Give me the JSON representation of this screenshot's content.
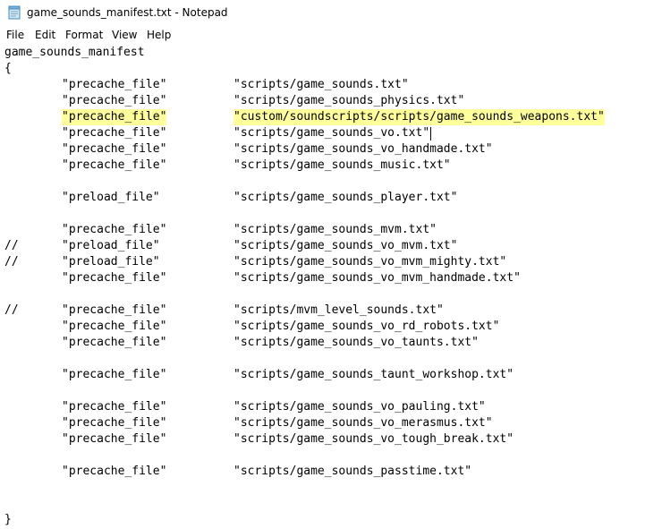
{
  "window": {
    "title": "game_sounds_manifest.txt - Notepad"
  },
  "menu": {
    "items": [
      "File",
      "Edit",
      "Format",
      "View",
      "Help"
    ]
  },
  "editor": {
    "lines": [
      {
        "c": "game_sounds_manifest",
        "k": "",
        "v": ""
      },
      {
        "c": "{",
        "k": "",
        "v": ""
      },
      {
        "c": "",
        "k": "\"precache_file\"",
        "v": "\"scripts/game_sounds.txt\""
      },
      {
        "c": "",
        "k": "\"precache_file\"",
        "v": "\"scripts/game_sounds_physics.txt\""
      },
      {
        "c": "",
        "k": "\"precache_file\"",
        "v": "\"custom/soundscripts/scripts/game_sounds_weapons.txt\""
      },
      {
        "c": "",
        "k": "\"precache_file\"",
        "v": "\"scripts/game_sounds_vo.txt\""
      },
      {
        "c": "",
        "k": "\"precache_file\"",
        "v": "\"scripts/game_sounds_vo_handmade.txt\""
      },
      {
        "c": "",
        "k": "\"precache_file\"",
        "v": "\"scripts/game_sounds_music.txt\""
      },
      {
        "c": "",
        "k": "",
        "v": ""
      },
      {
        "c": "",
        "k": "\"preload_file\"",
        "v": "\"scripts/game_sounds_player.txt\""
      },
      {
        "c": "",
        "k": "",
        "v": ""
      },
      {
        "c": "",
        "k": "\"precache_file\"",
        "v": "\"scripts/game_sounds_mvm.txt\""
      },
      {
        "c": "//",
        "k": "\"preload_file\"",
        "v": "\"scripts/game_sounds_vo_mvm.txt\""
      },
      {
        "c": "//",
        "k": "\"preload_file\"",
        "v": "\"scripts/game_sounds_vo_mvm_mighty.txt\""
      },
      {
        "c": "",
        "k": "\"precache_file\"",
        "v": "\"scripts/game_sounds_vo_mvm_handmade.txt\""
      },
      {
        "c": "",
        "k": "",
        "v": ""
      },
      {
        "c": "//",
        "k": "\"precache_file\"",
        "v": "\"scripts/mvm_level_sounds.txt\""
      },
      {
        "c": "",
        "k": "\"precache_file\"",
        "v": "\"scripts/game_sounds_vo_rd_robots.txt\""
      },
      {
        "c": "",
        "k": "\"precache_file\"",
        "v": "\"scripts/game_sounds_vo_taunts.txt\""
      },
      {
        "c": "",
        "k": "",
        "v": ""
      },
      {
        "c": "",
        "k": "\"precache_file\"",
        "v": "\"scripts/game_sounds_taunt_workshop.txt\""
      },
      {
        "c": "",
        "k": "",
        "v": ""
      },
      {
        "c": "",
        "k": "\"precache_file\"",
        "v": "\"scripts/game_sounds_vo_pauling.txt\""
      },
      {
        "c": "",
        "k": "\"precache_file\"",
        "v": "\"scripts/game_sounds_vo_merasmus.txt\""
      },
      {
        "c": "",
        "k": "\"precache_file\"",
        "v": "\"scripts/game_sounds_vo_tough_break.txt\""
      },
      {
        "c": "",
        "k": "",
        "v": ""
      },
      {
        "c": "",
        "k": "\"precache_file\"",
        "v": "\"scripts/game_sounds_passtime.txt\""
      },
      {
        "c": "",
        "k": "",
        "v": ""
      },
      {
        "c": "",
        "k": "",
        "v": ""
      },
      {
        "c": "}",
        "k": "",
        "v": ""
      }
    ],
    "highlight_line": 4,
    "caret_line": 5,
    "highlight_color": "#ffff9c"
  }
}
